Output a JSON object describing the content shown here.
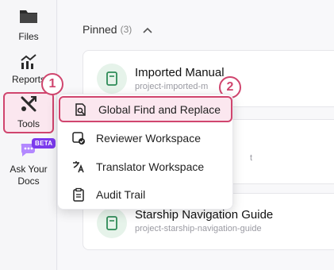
{
  "sidebar": {
    "items": [
      {
        "label": "Files",
        "icon": "folder-icon"
      },
      {
        "label": "Reports",
        "icon": "chart-icon"
      },
      {
        "label": "Tools",
        "icon": "tools-icon"
      },
      {
        "label": "Ask Your Docs",
        "icon": "chat-icon"
      }
    ],
    "beta_badge": "BETA"
  },
  "main": {
    "pinned_label": "Pinned",
    "pinned_count": "(3)",
    "cards": [
      {
        "title": "Imported Manual",
        "subtitle": "project-imported-m"
      },
      {
        "title": "",
        "subtitle": "t"
      },
      {
        "title": "Starship Navigation Guide",
        "subtitle": "project-starship-navigation-guide"
      }
    ]
  },
  "menu": {
    "items": [
      {
        "label": "Global Find and Replace",
        "icon": "find-replace-icon"
      },
      {
        "label": "Reviewer Workspace",
        "icon": "reviewer-icon"
      },
      {
        "label": "Translator Workspace",
        "icon": "translate-icon"
      },
      {
        "label": "Audit Trail",
        "icon": "clipboard-icon"
      }
    ]
  },
  "steps": [
    "1",
    "2"
  ],
  "colors": {
    "accent": "#d0456e",
    "highlight_bg": "#fbe7ef",
    "beta": "#7c3aed",
    "book": "#2e8b57"
  }
}
